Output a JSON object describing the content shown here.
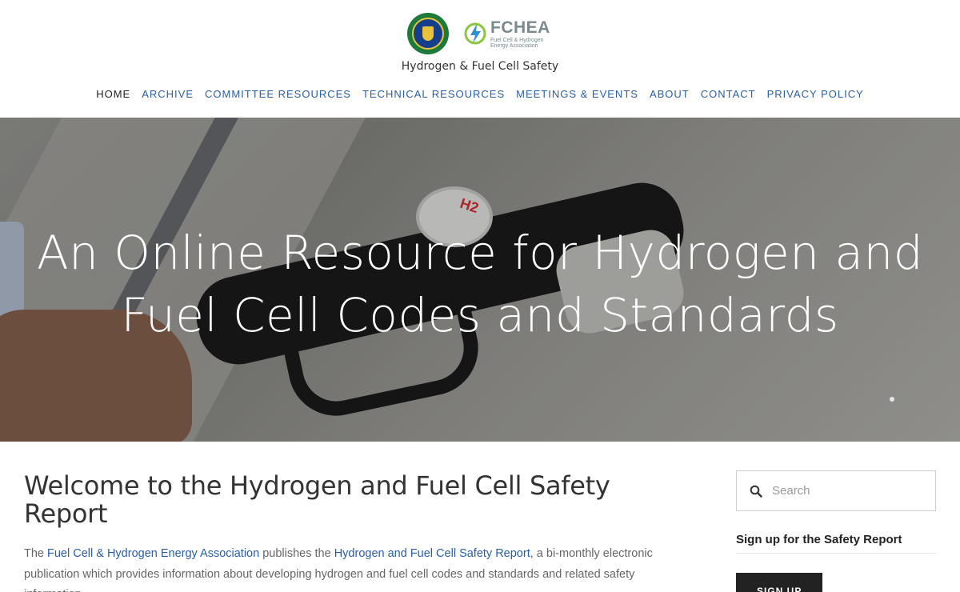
{
  "header": {
    "logos": {
      "doe_seal_icon": "doe-seal-icon",
      "fchea_name": "FCHEA",
      "fchea_subtitle": "Fuel Cell & Hydrogen Energy Association"
    },
    "site_title": "Hydrogen & Fuel Cell Safety",
    "nav": [
      {
        "label": "HOME",
        "active": true
      },
      {
        "label": "ARCHIVE"
      },
      {
        "label": "COMMITTEE RESOURCES"
      },
      {
        "label": "TECHNICAL RESOURCES"
      },
      {
        "label": "MEETINGS & EVENTS"
      },
      {
        "label": "ABOUT"
      },
      {
        "label": "CONTACT"
      },
      {
        "label": "PRIVACY POLICY"
      }
    ]
  },
  "hero": {
    "title_line1": "An Online Resource for Hydrogen and",
    "title_line2": "Fuel Cell Codes and Standards",
    "cap_label": "H2"
  },
  "main": {
    "heading": "Welcome to the Hydrogen and Fuel Cell Safety Report",
    "intro": {
      "part1": "The ",
      "link1": "Fuel Cell & Hydrogen Energy Association",
      "part2": " publishes the ",
      "link2": "Hydrogen and Fuel Cell Safety Report",
      "part3": ", a bi-monthly electronic publication which provides information about developing hydrogen and fuel cell codes and standards and related safety information."
    }
  },
  "sidebar": {
    "search_placeholder": "Search",
    "signup_heading": "Sign up for the Safety Report",
    "signup_button": "SIGN UP"
  },
  "colors": {
    "link": "#2a5ea8",
    "button_bg": "#222222",
    "heading": "#333333"
  }
}
